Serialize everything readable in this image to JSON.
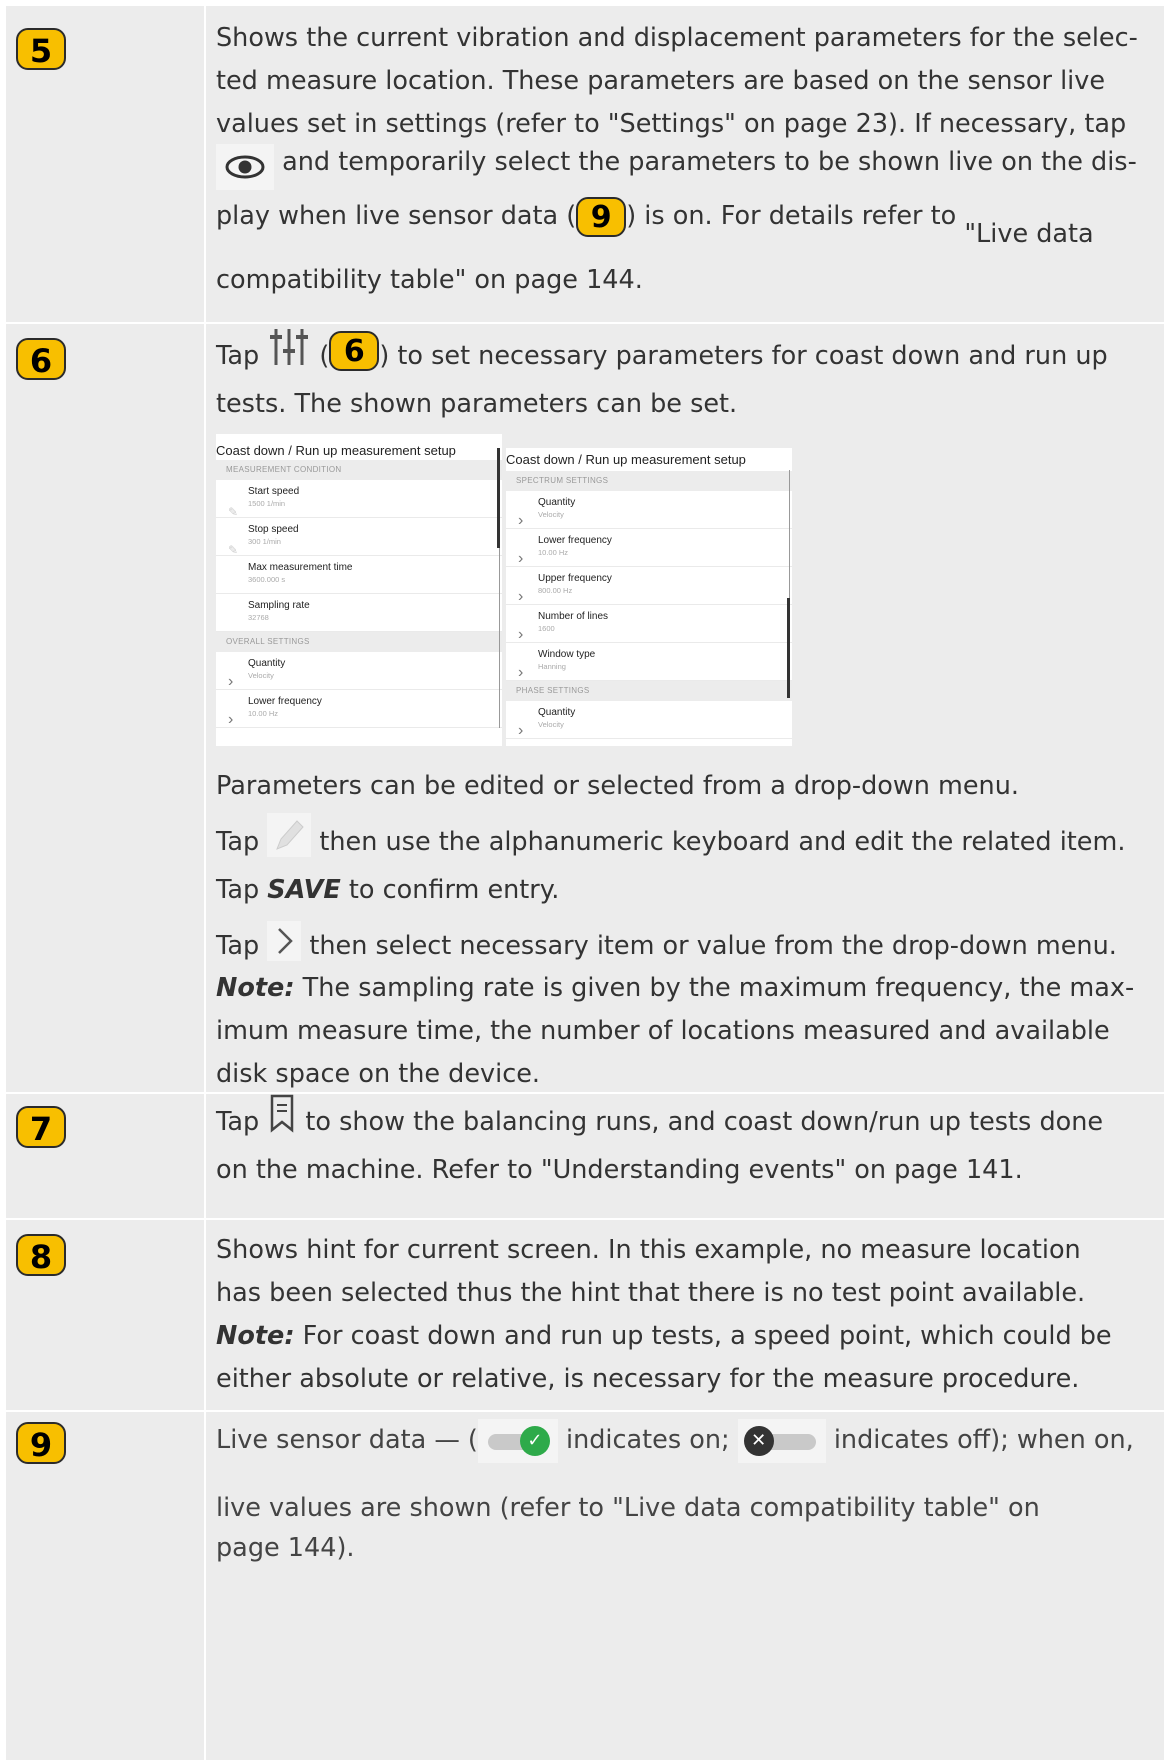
{
  "rows": {
    "r5": {
      "number": "5",
      "text_1": "Shows the current vibration and displacement parameters for the selec-",
      "text_2": "ted measure location. These parameters are based on the sensor live",
      "text_3": "values set in settings (refer to \"Settings\" on page 23). If necessary, tap",
      "text_4": "and temporarily select the parameters to be shown live on the dis-",
      "text_5a": "play when live sensor data (",
      "badge_ref": "9",
      "text_5b": ") is on. For details refer to",
      "text_5c": "\"Live data",
      "text_6": "compatibility table\" on page 144.",
      "eye_icon": "eye-icon"
    },
    "r6": {
      "number": "6",
      "tap": "Tap",
      "paren_open": "(",
      "badge_ref": "6",
      "text_1b": ") to set necessary parameters for coast down and run up",
      "text_2": "tests. The shown parameters can be set.",
      "filter_icon": "sliders-icon",
      "screen_left": {
        "title": "Coast down / Run up measurement setup",
        "section_1": "MEASUREMENT CONDITION",
        "items_1": [
          {
            "label": "Start speed",
            "value": "1500 1/min",
            "icon": "edit"
          },
          {
            "label": "Stop speed",
            "value": "300 1/min",
            "icon": "edit"
          },
          {
            "label": "Max measurement time",
            "value": "3600.000 s",
            "icon": ""
          },
          {
            "label": "Sampling rate",
            "value": "32768",
            "icon": ""
          }
        ],
        "section_2": "OVERALL SETTINGS",
        "items_2": [
          {
            "label": "Quantity",
            "value": "Velocity",
            "icon": "chevron"
          },
          {
            "label": "Lower frequency",
            "value": "10.00 Hz",
            "icon": "chevron"
          }
        ]
      },
      "screen_right": {
        "title": "Coast down / Run up measurement setup",
        "section_1": "SPECTRUM SETTINGS",
        "items_1": [
          {
            "label": "Quantity",
            "value": "Velocity"
          },
          {
            "label": "Lower frequency",
            "value": "10.00 Hz"
          },
          {
            "label": "Upper frequency",
            "value": "800.00 Hz"
          },
          {
            "label": "Number of lines",
            "value": "1600"
          },
          {
            "label": "Window type",
            "value": "Hanning"
          }
        ],
        "section_2": "PHASE SETTINGS",
        "items_2": [
          {
            "label": "Quantity",
            "value": "Velocity"
          }
        ]
      },
      "text_3": "Parameters can be edited or selected from a drop-down menu.",
      "text_4a": "Tap",
      "text_4b": "then use the alphanumeric keyboard and edit the related item.",
      "text_5a": "Tap",
      "save": "SAVE",
      "text_5b": "to confirm entry.",
      "text_6a": "Tap",
      "text_6b": "then select necessary item or value from the drop-down menu.",
      "note_label": "Note:",
      "note_1": "The sampling rate is given by the maximum frequency, the max-",
      "note_2": "imum measure time, the number of locations measured and available",
      "note_3": "disk space on the device."
    },
    "r7": {
      "number": "7",
      "tap": "Tap",
      "text_1b": "to show the balancing runs, and coast down/run up tests done",
      "text_2": "on the machine. Refer to \"Understanding events\" on page 141.",
      "events_icon": "bookmark-list-icon"
    },
    "r8": {
      "number": "8",
      "text_1": "Shows hint for current screen. In this example, no measure location",
      "text_2": "has been selected thus the hint that there is no test point available.",
      "note_label": "Note:",
      "note_1": "For coast down and run up tests, a speed point, which could be",
      "note_2": "either absolute or relative, is necessary for the measure procedure."
    },
    "r9": {
      "number": "9",
      "text_1a": "Live sensor data — (",
      "text_1b": "indicates on;",
      "text_1c": "indicates off); when on,",
      "text_2": "live values are shown (refer to \"Live data compatibility table\" on",
      "text_3": "page 144)."
    }
  },
  "colors": {
    "badge": "#f8bf00",
    "row_bg": "#ececec",
    "toggle_on": "#2eaa4a",
    "toggle_off": "#333333"
  }
}
